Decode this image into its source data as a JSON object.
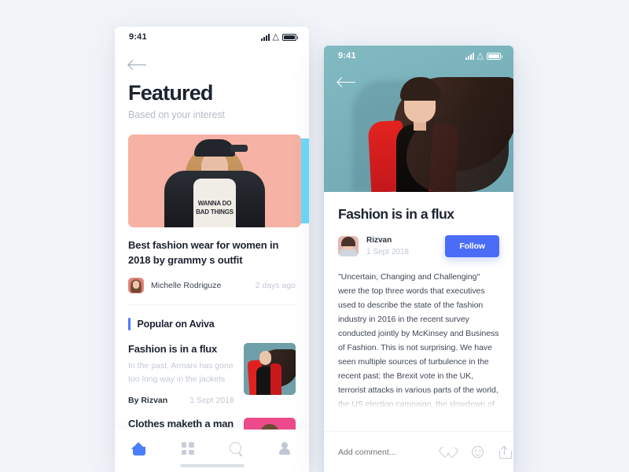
{
  "background_color": "#f1f4f9",
  "accent_color": "#4a6cf7",
  "left_phone": {
    "status_bar": {
      "time": "9:41",
      "icons": [
        "signal-icon",
        "wifi-icon",
        "battery-icon"
      ]
    },
    "back_button": "back-arrow-icon",
    "page_title": "Featured",
    "page_subtitle": "Based on your interest",
    "carousel": {
      "peek_card_color": "#6ed8f7",
      "featured_card": {
        "image_alt": "woman-in-leather-jacket-on-pink-background",
        "shirt_text": "WANNA DO BAD THINGS",
        "background_color": "#f6b2a5"
      }
    },
    "featured_article": {
      "title": "Best fashion wear for women in 2018 by grammy s outfit",
      "author": "Michelle Rodriguze",
      "timestamp": "2 days ago",
      "avatar_alt": "michelle-avatar"
    },
    "section": {
      "title": "Popular on Aviva",
      "accent_color": "#4a7dfb"
    },
    "popular_items": [
      {
        "title": "Fashion is in a flux",
        "description": "In the past, Armani has gone too long way in the jackets",
        "author": "By Rizvan",
        "date": "1 Sept 2018",
        "thumbnail_alt": "woman-in-red-blazer-teal-thumbnail"
      },
      {
        "title": "Clothes maketh a man",
        "description": "",
        "author": "",
        "date": "",
        "thumbnail_alt": "pink-portrait-thumbnail"
      }
    ],
    "tab_bar": [
      {
        "name": "home",
        "icon": "home-icon",
        "active": true
      },
      {
        "name": "categories",
        "icon": "grid-icon",
        "active": false
      },
      {
        "name": "search",
        "icon": "search-icon",
        "active": false
      },
      {
        "name": "profile",
        "icon": "user-icon",
        "active": false
      }
    ]
  },
  "right_phone": {
    "status_bar": {
      "time": "9:41",
      "icons": [
        "signal-icon",
        "wifi-icon",
        "battery-icon"
      ]
    },
    "back_button": "back-arrow-icon",
    "hero": {
      "image_alt": "woman-in-red-blazer-with-flowing-hair-on-teal-background",
      "background_color": "#7ab4bd"
    },
    "article": {
      "title": "Fashion is in a flux",
      "author": "Rizvan",
      "date": "1 Sept 2018",
      "follow_label": "Follow",
      "avatar_alt": "rizvan-avatar",
      "body": "\"Uncertain, Changing and Challenging\" were the top three words that executives used to describe the state of the fashion industry in 2016 in the recent survey conducted jointly by McKinsey and Business of Fashion. This is not surprising. We have seen multiple sources of turbulence in the recent past: the Brexit vote in the UK, terrorist attacks in various parts of the world, the US election campaign, the slowdown of the Chinese economy, overall volatility of the stock market, digital disruptions in various forms, rapidly evolving consumer expectations and"
    },
    "comment_bar": {
      "placeholder": "Add comment...",
      "icons": [
        "heart-icon",
        "smiley-icon",
        "share-icon"
      ]
    }
  }
}
